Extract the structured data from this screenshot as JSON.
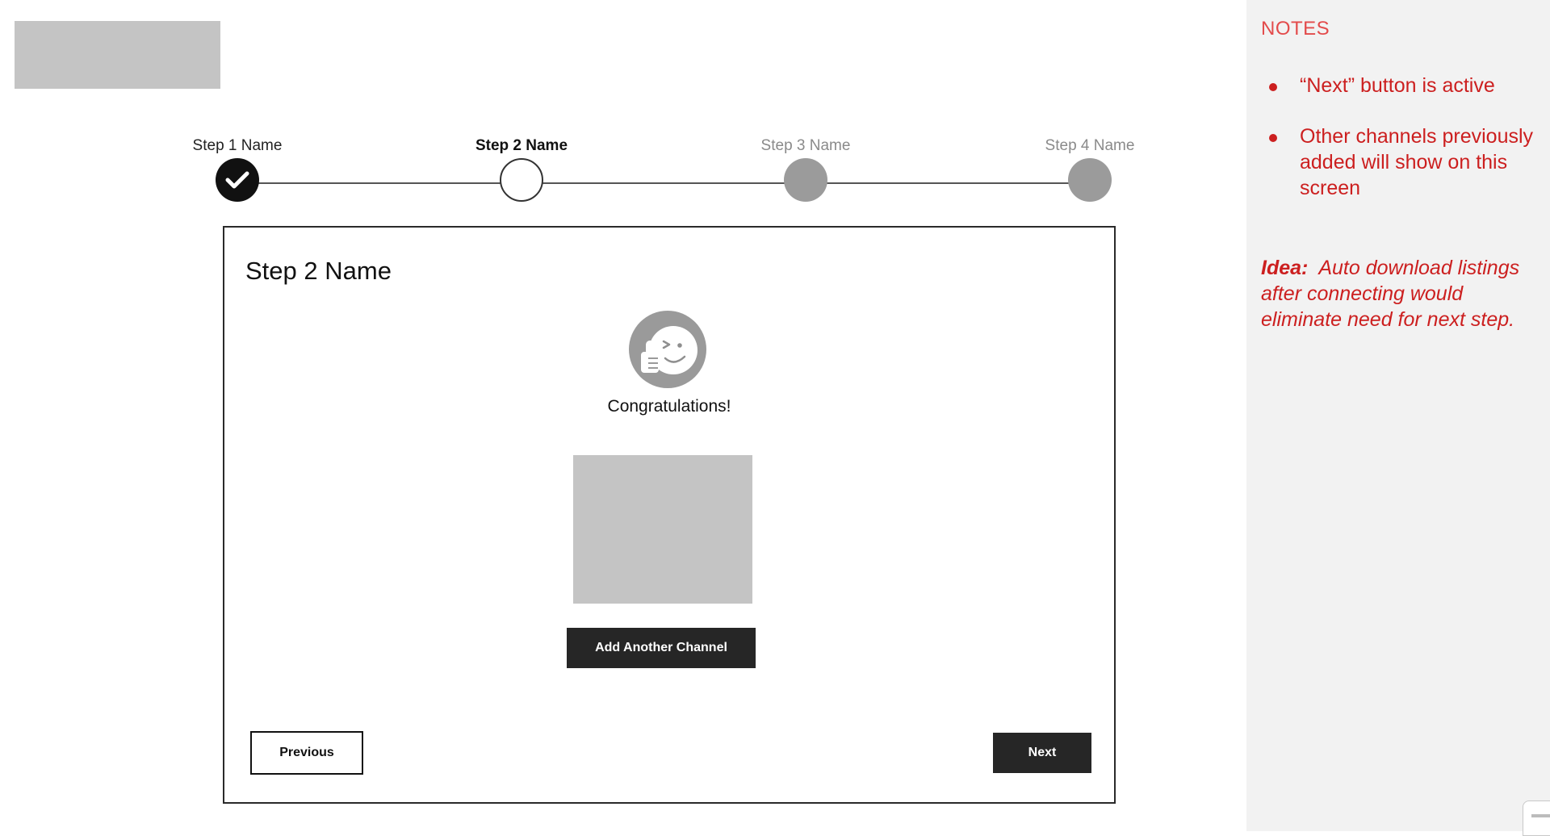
{
  "stepper": {
    "steps": [
      {
        "label": "Step 1 Name",
        "state": "completed"
      },
      {
        "label": "Step 2 Name",
        "state": "current"
      },
      {
        "label": "Step 3 Name",
        "state": "upcoming"
      },
      {
        "label": "Step 4 Name",
        "state": "upcoming"
      }
    ]
  },
  "card": {
    "title": "Step 2 Name",
    "icon": "thumbs-up-smiley-icon",
    "congrats_text": "Congratulations!",
    "add_channel_label": "Add Another Channel",
    "previous_label": "Previous",
    "next_label": "Next"
  },
  "notes": {
    "title": "NOTES",
    "items": [
      "“Next” button is active",
      "Other channels previously added will show on this screen"
    ],
    "idea_label": "Idea:",
    "idea_text": "Auto download listings after connecting would eliminate need for next step."
  },
  "colors": {
    "dark_button": "#262626",
    "notes_red": "#cc1f1f",
    "notes_title_red": "#e34b4b",
    "placeholder_gray": "#c4c4c4",
    "upcoming_step_gray": "#9b9b9b"
  }
}
